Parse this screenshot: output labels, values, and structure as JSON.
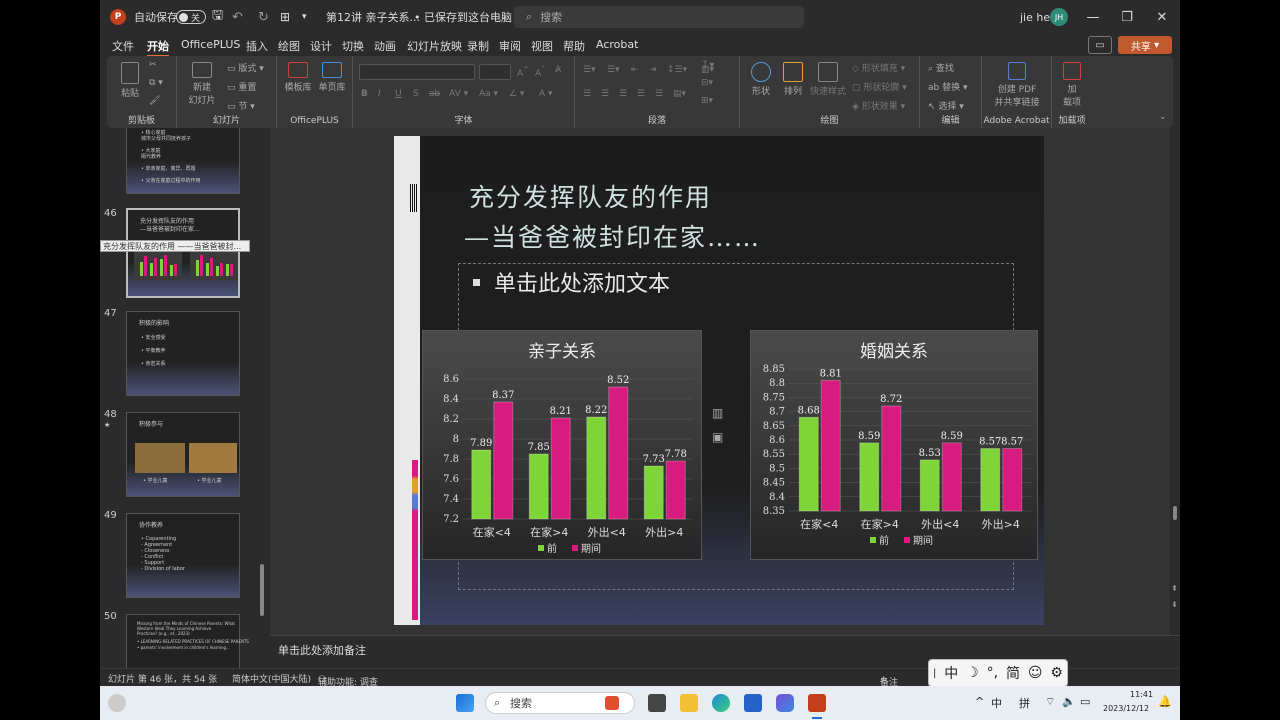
{
  "titlebar": {
    "autosave_label": "自动保存",
    "autosave_state": "关",
    "filename": "第12讲 亲子关系...",
    "save_status": "• 已保存到这台电脑",
    "search_placeholder": "搜索",
    "user_name": "jie he",
    "user_initials": "JH"
  },
  "menu": {
    "tabs": [
      "文件",
      "开始",
      "OfficePLUS",
      "插入",
      "绘图",
      "设计",
      "切换",
      "动画",
      "幻灯片放映",
      "录制",
      "审阅",
      "视图",
      "帮助",
      "Acrobat"
    ],
    "active_tab": "开始",
    "share_label": "共享"
  },
  "ribbon": {
    "groups": {
      "clipboard": "剪贴板",
      "slides": "幻灯片",
      "officeplus": "OfficePLUS",
      "font": "字体",
      "paragraph": "段落",
      "drawing": "绘图",
      "editing": "编辑",
      "acrobat": "Adobe Acrobat",
      "addins": "加载项"
    },
    "items": {
      "paste": "粘贴",
      "new_slide_1": "新建",
      "new_slide_2": "幻灯片",
      "layout": "版式",
      "reset": "重置",
      "section": "节",
      "template_lib": "模板库",
      "single_page_lib": "单页库",
      "shapes": "形状",
      "arrange": "排列",
      "quick_styles": "快速样式",
      "shape_fill": "形状填充",
      "shape_outline": "形状轮廓",
      "shape_effects": "形状效果",
      "find": "查找",
      "replace": "替换",
      "select": "选择",
      "create_pdf_1": "创建 PDF",
      "create_pdf_2": "并共享链接",
      "addins_1": "加",
      "addins_2": "载项"
    }
  },
  "thumbnails": {
    "numbers": [
      "46",
      "47",
      "48",
      "49",
      "50"
    ],
    "slide45_lines": [
      "• 核心家庭",
      "  城市父母共同抚养孩子",
      "• 大家庭",
      "  隔代教养",
      "• 单亲家庭、离异、再婚",
      "• 父亲在家庭过程中的作用"
    ],
    "slide46_lines": [
      "充分发挥队友的作用",
      "—当爸爸被封印在家..."
    ],
    "tooltip": "充分发挥队友的作用 ——当爸爸被封...",
    "slide47_lines": [
      "积极的影响",
      "• 安全感受",
      "• 平衡教养",
      "• 亲密关系"
    ],
    "slide48_lines": [
      "积极参与",
      "• 学业儿童",
      "• 学业儿童"
    ],
    "slide49_lines": [
      "协作教养",
      "• Coparenting",
      "  - Agreement",
      "  - Closeness",
      "  - Conflict",
      "  - Support",
      "  - Division of labor"
    ],
    "slide50_lines": [
      "Missing from the Minds of Chinese Parents: What",
      "Western Ideal They Learning Achieve",
      "Practices? (e.g., et., 2023)",
      "• LEARNING-RELATED PRACTICES OF CHINESE PARENTS",
      "• parents' involvement in children's learning..."
    ]
  },
  "slide": {
    "title_line1": "充分发挥队友的作用",
    "title_line2": "—当爸爸被封印在家……",
    "placeholder": "单击此处添加文本"
  },
  "chart_data": [
    {
      "type": "bar",
      "title": "亲子关系",
      "categories": [
        "在家<4",
        "在家>4",
        "外出<4",
        "外出>4"
      ],
      "series": [
        {
          "name": "前",
          "values": [
            7.89,
            7.85,
            8.22,
            7.73
          ]
        },
        {
          "name": "期间",
          "values": [
            8.37,
            8.21,
            8.52,
            7.78
          ]
        }
      ],
      "ylim": [
        7.2,
        8.6
      ],
      "yticks": [
        "7.2",
        "7.4",
        "7.6",
        "7.8",
        "8",
        "8.2",
        "8.4",
        "8.6"
      ],
      "legend": "bottom",
      "colors": [
        "#7fd43a",
        "#d81b7f"
      ]
    },
    {
      "type": "bar",
      "title": "婚姻关系",
      "categories": [
        "在家<4",
        "在家>4",
        "外出<4",
        "外出>4"
      ],
      "series": [
        {
          "name": "前",
          "values": [
            8.68,
            8.59,
            8.53,
            8.57
          ]
        },
        {
          "name": "期间",
          "values": [
            8.81,
            8.72,
            8.59,
            8.57
          ]
        }
      ],
      "ylim": [
        8.35,
        8.85
      ],
      "yticks": [
        "8.35",
        "8.4",
        "8.45",
        "8.5",
        "8.55",
        "8.6",
        "8.65",
        "8.7",
        "8.75",
        "8.8",
        "8.85"
      ],
      "legend": "bottom",
      "colors": [
        "#7fd43a",
        "#d81b7f"
      ]
    }
  ],
  "notes": {
    "placeholder": "单击此处添加备注"
  },
  "statusbar": {
    "slide_info": "幻灯片 第 46 张，共 54 张",
    "language": "简体中文(中国大陆)",
    "accessibility": "辅助功能: 调查",
    "notes_label": "备注"
  },
  "ime": {
    "chars": [
      "中",
      "简"
    ]
  },
  "taskbar": {
    "search_placeholder": "搜索",
    "ime_lang": "中",
    "ime_mode": "拼",
    "time": "11:41",
    "date": "2023/12/12"
  }
}
